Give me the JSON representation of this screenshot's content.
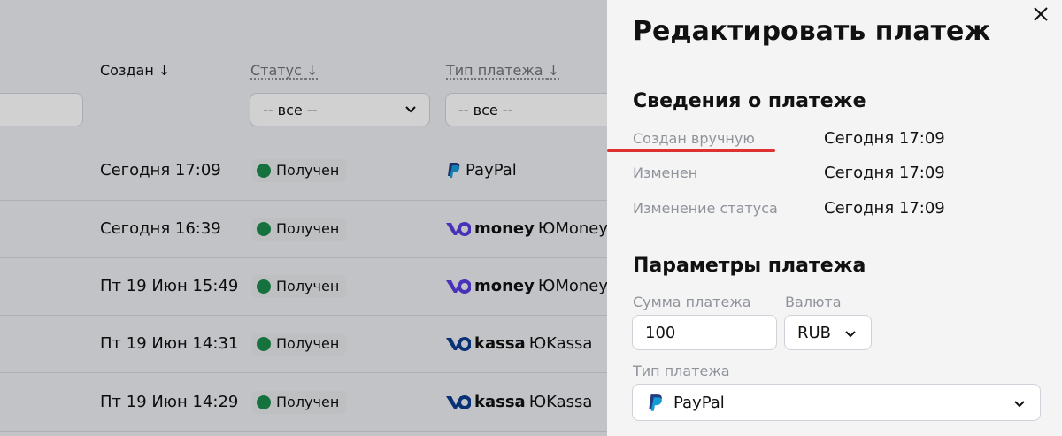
{
  "table": {
    "headers": {
      "created": "Создан",
      "status": "Статус",
      "payment_type": "Тип платежа"
    },
    "filters": {
      "status": "-- все --",
      "payment_type": "-- все --"
    },
    "rows": [
      {
        "date": "Сегодня 17:09",
        "status": "Получен",
        "type_brand": "",
        "type_name": "PayPal",
        "type_icon": "paypal-icon"
      },
      {
        "date": "Сегодня 16:39",
        "status": "Получен",
        "type_brand": "money",
        "type_name": "ЮMoney",
        "type_icon": "yumoney-icon"
      },
      {
        "date": "Пт 19 Июн 15:49",
        "status": "Получен",
        "type_brand": "money",
        "type_name": "ЮMoney",
        "type_icon": "yumoney-icon"
      },
      {
        "date": "Пт 19 Июн 14:31",
        "status": "Получен",
        "type_brand": "kassa",
        "type_name": "ЮKassa",
        "type_icon": "yukassa-icon"
      },
      {
        "date": "Пт 19 Июн 14:29",
        "status": "Получен",
        "type_brand": "kassa",
        "type_name": "ЮKassa",
        "type_icon": "yukassa-icon"
      }
    ]
  },
  "panel": {
    "title": "Редактировать платеж",
    "info": {
      "title": "Сведения о платеже",
      "items": [
        {
          "label": "Создан вручную",
          "value": "Сегодня 17:09"
        },
        {
          "label": "Изменен",
          "value": "Сегодня 17:09"
        },
        {
          "label": "Изменение статуса",
          "value": "Сегодня 17:09"
        }
      ]
    },
    "params": {
      "title": "Параметры платежа",
      "amount_label": "Сумма платежа",
      "amount_value": "100",
      "currency_label": "Валюта",
      "currency_value": "RUB",
      "type_label": "Тип платежа",
      "type_value": "PayPal"
    }
  },
  "colors": {
    "status_ok": "#1a8a4c",
    "annotation": "#e03131",
    "brand_icon": "#5a3ee0",
    "kassa_icon": "#0a3d8f",
    "paypal_dark": "#253b80",
    "paypal_light": "#179bd7"
  }
}
